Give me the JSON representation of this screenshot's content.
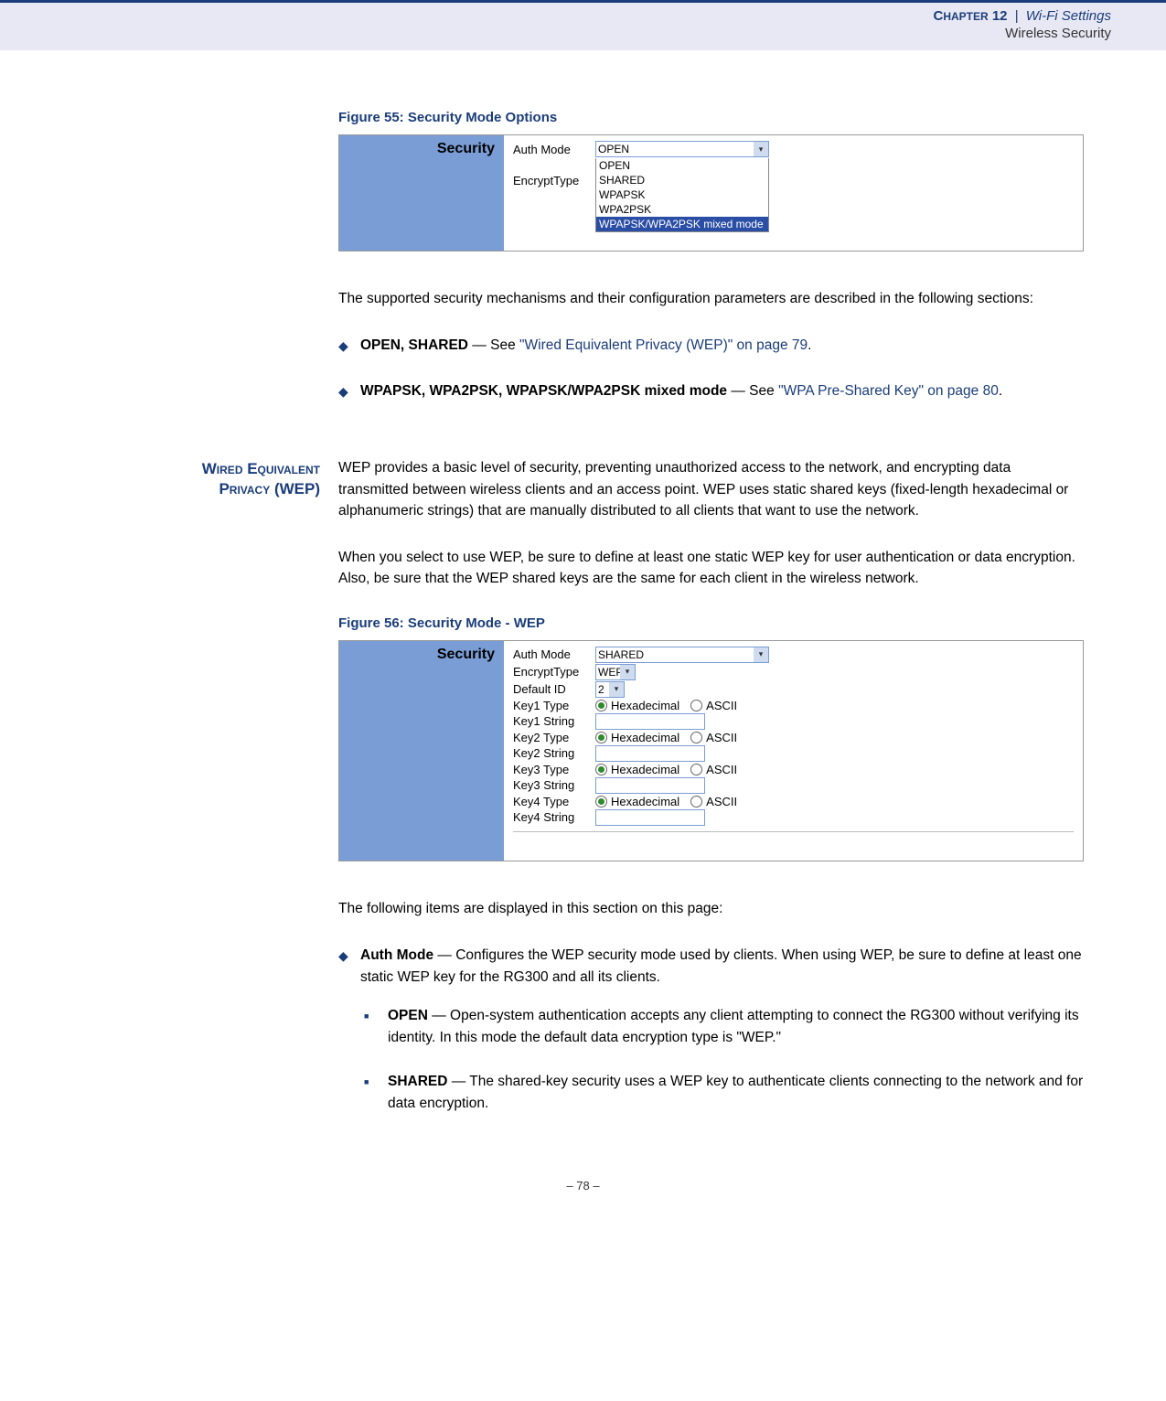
{
  "header": {
    "chapter_label_prefix": "C",
    "chapter_label_rest": "HAPTER",
    "chapter_num": " 12",
    "sep": "|",
    "chapter_name": "Wi-Fi Settings",
    "subsection": "Wireless Security"
  },
  "figure55": {
    "caption": "Figure 55:  Security Mode Options",
    "panel_title": "Security",
    "auth_label": "Auth Mode",
    "encrypt_label": "EncryptType",
    "auth_value": "OPEN",
    "options": {
      "o1": "OPEN",
      "o2": "SHARED",
      "o3": "WPAPSK",
      "o4": "WPA2PSK",
      "o5": "WPAPSK/WPA2PSK mixed mode"
    }
  },
  "intro_para": "The supported security mechanisms and their configuration parameters are described in the following sections:",
  "bullets": {
    "b1_strong": "OPEN, SHARED",
    "b1_mid": " — See ",
    "b1_link": "\"Wired Equivalent Privacy (WEP)\" on page 79",
    "b1_end": ".",
    "b2_strong": "WPAPSK, WPA2PSK, WPAPSK/WPA2PSK mixed mode",
    "b2_mid": " — See ",
    "b2_link": "\"WPA Pre-Shared Key\" on page 80",
    "b2_end": "."
  },
  "wep_section": {
    "heading_line1": "Wired Equivalent",
    "heading_line2": "Privacy (WEP)",
    "para1": "WEP provides a basic level of security, preventing unauthorized access to the network, and encrypting data transmitted between wireless clients and an access point. WEP uses static shared keys (fixed-length hexadecimal or alphanumeric strings) that are manually distributed to all clients that want to use the network.",
    "para2": "When you select to use WEP, be sure to define at least one static WEP key for user authentication or data encryption. Also, be sure that the WEP shared keys are the same for each client in the wireless network."
  },
  "figure56": {
    "caption": "Figure 56:  Security Mode - WEP",
    "panel_title": "Security",
    "labels": {
      "auth": "Auth Mode",
      "encrypt": "EncryptType",
      "default_id": "Default ID",
      "k1t": "Key1 Type",
      "k1s": "Key1 String",
      "k2t": "Key2 Type",
      "k2s": "Key2 String",
      "k3t": "Key3 Type",
      "k3s": "Key3 String",
      "k4t": "Key4 Type",
      "k4s": "Key4 String"
    },
    "values": {
      "auth": "SHARED",
      "encrypt": "WEP",
      "default_id": "2",
      "hex": "Hexadecimal",
      "ascii": "ASCII"
    }
  },
  "items_intro": "The following items are displayed in this section on this page:",
  "auth_item": {
    "strong": "Auth Mode",
    "desc": " — Configures the WEP security mode used by clients. When using WEP, be sure to define at least one static WEP key for the RG300 and all its clients.",
    "open_strong": "OPEN",
    "open_desc": " — Open-system authentication accepts any client attempting to connect the RG300 without verifying its identity. In this mode the default data encryption type is \"WEP.\"",
    "shared_strong": "SHARED",
    "shared_desc": " — The shared-key security uses a WEP key to authenticate clients connecting to the network and for data encryption."
  },
  "page_number": "–  78  –"
}
